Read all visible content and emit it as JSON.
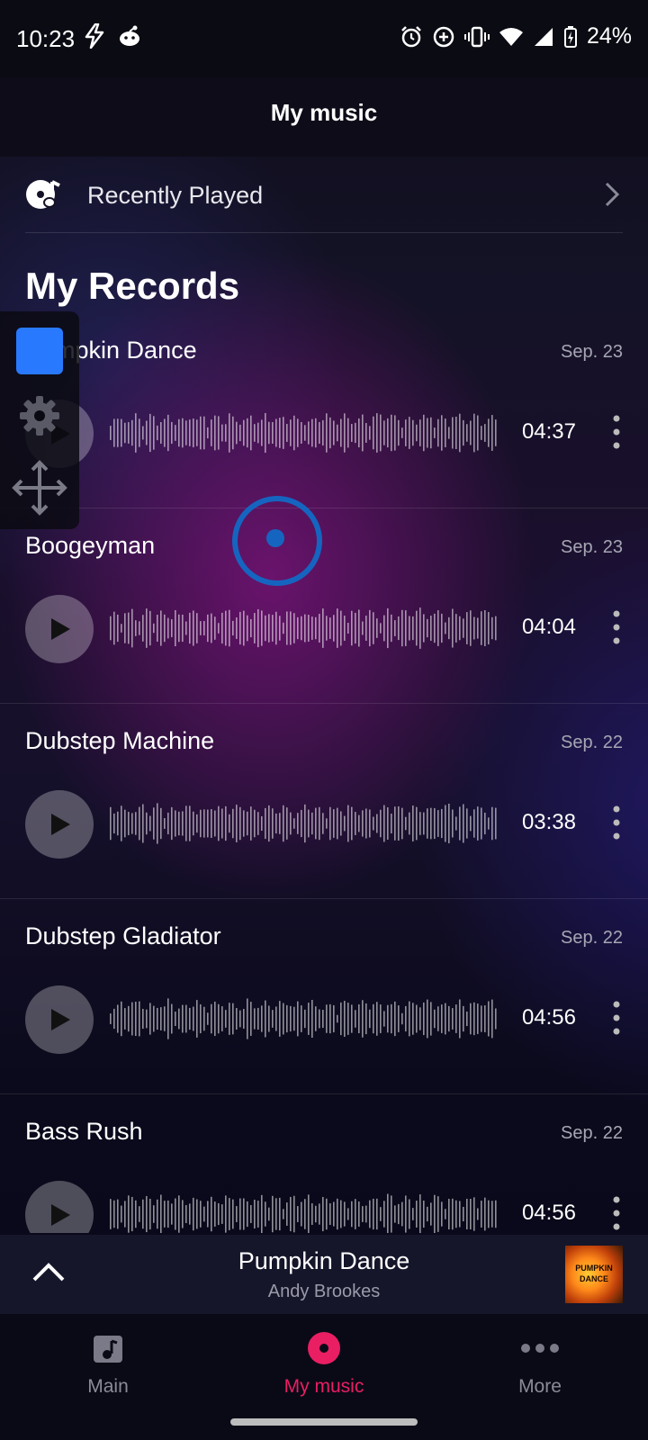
{
  "status_bar": {
    "time": "10:23",
    "battery": "24%"
  },
  "header": {
    "title": "My music"
  },
  "recently_played": {
    "label": "Recently Played"
  },
  "section": {
    "title": "My Records"
  },
  "records": [
    {
      "title": "Pumpkin Dance",
      "date": "Sep. 23",
      "duration": "04:37"
    },
    {
      "title": "Boogeyman",
      "date": "Sep. 23",
      "duration": "04:04"
    },
    {
      "title": "Dubstep Machine",
      "date": "Sep. 22",
      "duration": "03:38"
    },
    {
      "title": "Dubstep Gladiator",
      "date": "Sep. 22",
      "duration": "04:56"
    },
    {
      "title": "Bass Rush",
      "date": "Sep. 22",
      "duration": "04:56"
    }
  ],
  "mini_player": {
    "title": "Pumpkin Dance",
    "artist": "Andy Brookes",
    "art_text_1": "PUMPKIN",
    "art_text_2": "DANCE"
  },
  "bottom_nav": {
    "items": [
      {
        "label": "Main",
        "icon": "music-note-icon"
      },
      {
        "label": "My music",
        "icon": "record-icon",
        "active": true
      },
      {
        "label": "More",
        "icon": "more-dots-icon"
      }
    ]
  },
  "colors": {
    "accent": "#e91e63",
    "overlay_blue": "#2979ff",
    "touch_ring": "#1565c0"
  }
}
